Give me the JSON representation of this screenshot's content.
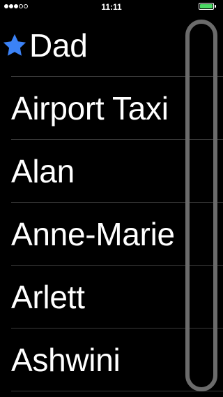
{
  "status_bar": {
    "time": "11:11",
    "signal_strength": 3,
    "signal_max": 5,
    "battery_level": 1.0,
    "battery_color": "#4cd964"
  },
  "contacts": {
    "items": [
      {
        "name": "Dad",
        "favorite": true,
        "favorite_icon": "star-icon",
        "favorite_color": "#3b82f6"
      },
      {
        "name": "Airport Taxi",
        "favorite": false
      },
      {
        "name": "Alan",
        "favorite": false
      },
      {
        "name": "Anne-Marie",
        "favorite": false
      },
      {
        "name": "Arlett",
        "favorite": false
      },
      {
        "name": "Ashwini",
        "favorite": false
      }
    ]
  },
  "scroll_bar": {
    "color": "#6b6b6b"
  }
}
